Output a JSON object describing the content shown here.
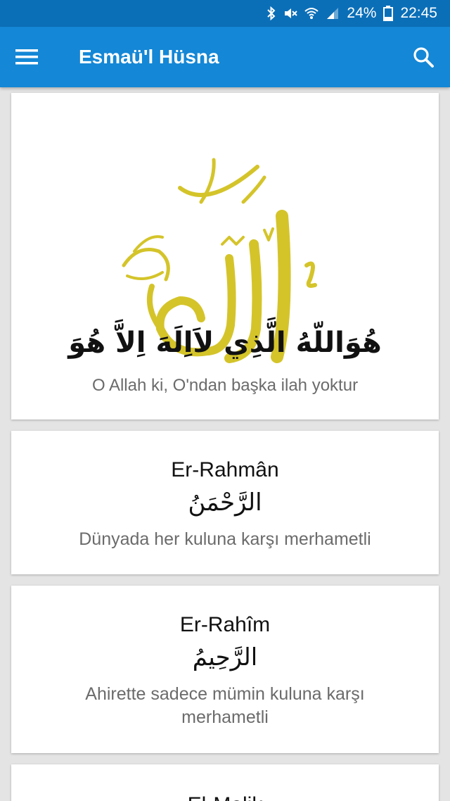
{
  "status_bar": {
    "battery_percent": "24%",
    "time": "22:45",
    "icons": [
      "bluetooth-icon",
      "mute-icon",
      "wifi-icon",
      "signal-icon",
      "battery-icon"
    ]
  },
  "app_bar": {
    "title": "Esmaü'l Hüsna",
    "menu_icon": "hamburger-menu-icon",
    "search_icon": "search-icon"
  },
  "header": {
    "calligraphy": "الله جل جلاله",
    "arabic": "هُوَاللّهُ الَّذِي لاَاِلَهَ اِلاَّ هُوَ",
    "meaning": "O Allah ki, O'ndan başka ilah yoktur"
  },
  "names": [
    {
      "title": "Er-Rahmân",
      "arabic": "الرَّحْمَنُ",
      "meaning": "Dünyada her kuluna karşı merhametli"
    },
    {
      "title": "Er-Rahîm",
      "arabic": "الرَّحِيمُ",
      "meaning": "Ahirette sadece mümin kuluna karşı merhametli"
    },
    {
      "title": "El-Melik"
    }
  ],
  "colors": {
    "status_bar": "#0b6fb8",
    "app_bar": "#1487d6",
    "background": "#e4e4e4",
    "calligraphy_gold": "#d4c42a"
  }
}
